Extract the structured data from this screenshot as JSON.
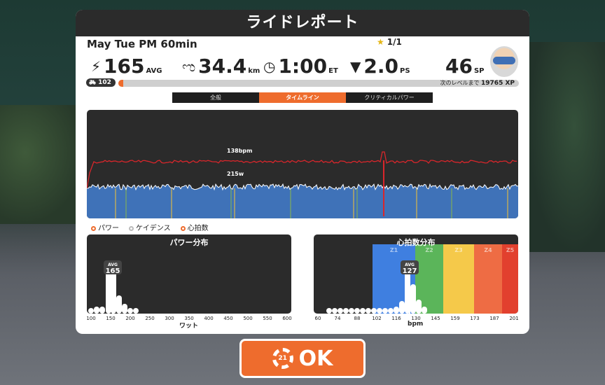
{
  "header": {
    "title": "ライドレポート"
  },
  "ride": {
    "title": "May Tue PM 60min",
    "badge": "1/1"
  },
  "stats": {
    "power": {
      "value": "165",
      "unit": "AVG",
      "icon": "lightning-icon"
    },
    "distance": {
      "value": "34.4",
      "unit": "km",
      "icon": "route-icon"
    },
    "time": {
      "value": "1:00",
      "unit": "ET",
      "icon": "clock-icon"
    },
    "pace": {
      "value": "2.0",
      "unit": "PS",
      "icon": "pace-icon"
    },
    "sp": {
      "value": "46",
      "unit": "SP"
    }
  },
  "level": {
    "value": "102",
    "xp_label": "次のレベルまで",
    "xp_value": "19765 XP",
    "xp_progress": 0.012
  },
  "tabs": [
    {
      "label": "全般"
    },
    {
      "label": "タイムライン"
    },
    {
      "label": "クリティカルパワー"
    }
  ],
  "timeline": {
    "hr_label": "138bpm",
    "power_label": "215w",
    "colors": {
      "hr": "#d9262b",
      "power_fill": "#3f72b8",
      "power_line": "#ffffff"
    }
  },
  "legend": {
    "power": "パワー",
    "cadence": "ケイデンス",
    "hr": "心拍数"
  },
  "power_dist": {
    "title": "パワー分布",
    "avg_label": "AVG",
    "avg_value": "165",
    "ticks": [
      "100",
      "150",
      "200",
      "250",
      "300",
      "350",
      "400",
      "450",
      "500",
      "550",
      "600"
    ],
    "xlabel": "ワット"
  },
  "hr_dist": {
    "title": "心拍数分布",
    "avg_label": "AVG",
    "avg_value": "127",
    "ticks": [
      "60",
      "74",
      "88",
      "102",
      "116",
      "130",
      "145",
      "159",
      "173",
      "187",
      "201"
    ],
    "xlabel": "bpm",
    "zones": [
      {
        "label": "Z1",
        "color": "#3f7fe0"
      },
      {
        "label": "Z2",
        "color": "#5bb55a"
      },
      {
        "label": "Z3",
        "color": "#f5c94a"
      },
      {
        "label": "Z4",
        "color": "#ee6c44"
      },
      {
        "label": "Z5",
        "color": "#e2402e"
      }
    ]
  },
  "ok_button": {
    "label": "OK",
    "countdown": "21"
  },
  "colors": {
    "accent": "#ee6c2d",
    "dark": "#2b2b2b"
  }
}
